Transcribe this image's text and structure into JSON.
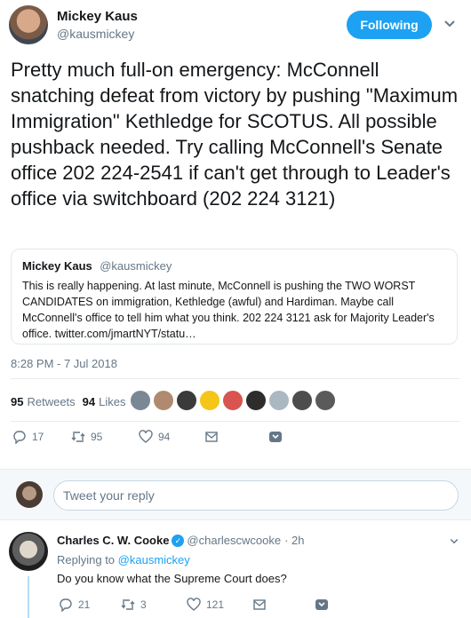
{
  "tweet": {
    "name": "Mickey Kaus",
    "handle": "@kausmickey",
    "follow_label": "Following",
    "text": "Pretty much full-on emergency: McConnell snatching defeat from victory by pushing \"Maximum Immigration\" Kethledge for SCOTUS. All possible pushback needed. Try calling McConnell's Senate office 202 224-2541 if can't get through to Leader's office via switchboard  (202 224 3121)",
    "timestamp": "8:28 PM - 7 Jul 2018",
    "retweets_count": "95",
    "retweets_label": "Retweets",
    "likes_count": "94",
    "likes_label": "Likes",
    "actions": {
      "reply_count": "17",
      "retweet_count": "95",
      "like_count": "94"
    }
  },
  "quote": {
    "name": "Mickey Kaus",
    "handle": "@kausmickey",
    "text": "This is really happening. At last minute, McConnell is pushing the TWO WORST CANDIDATES on immigration, Kethledge (awful) and Hardiman. Maybe call McConnell's office to tell him what you think. 202 224 3121 ask for Majority Leader's office. twitter.com/jmartNYT/statu…"
  },
  "liker_faces": [
    "#7b8794",
    "#b08a6e",
    "#3a3a3a",
    "#f5c518",
    "#d9534f",
    "#2d2d2d",
    "#aab8c2",
    "#4d4d4d",
    "#5a5a5a"
  ],
  "reply_box": {
    "placeholder": "Tweet your reply"
  },
  "reply": {
    "name": "Charles C. W. Cooke",
    "handle": "@charlescwcooke",
    "time": "· 2h",
    "replying_prefix": "Replying to",
    "replying_to": "@kausmickey",
    "text": "Do you know what the Supreme Court does?",
    "actions": {
      "reply_count": "21",
      "retweet_count": "3",
      "like_count": "121"
    }
  },
  "colors": {
    "accent": "#1da1f2",
    "muted": "#657786",
    "text": "#14171a"
  },
  "icons": [
    "reply-icon",
    "retweet-icon",
    "like-icon",
    "message-icon",
    "share-icon",
    "chevron-down-icon",
    "verified-icon"
  ]
}
